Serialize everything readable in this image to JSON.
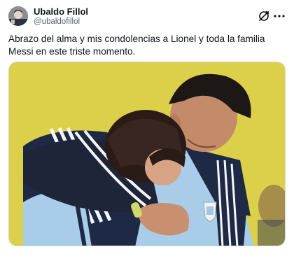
{
  "tweet": {
    "author": {
      "display_name": "Ubaldo Fillol",
      "handle": "@ubaldofillol"
    },
    "text": "Abrazo del alma y mis condolencias a Lionel y toda la familia Messi en este triste momento.",
    "header_icons": [
      "grok-icon",
      "more-options-icon"
    ],
    "media": {
      "type": "photo",
      "kit_colors": {
        "sky_blue": "#a9cde8",
        "navy": "#1e2a45",
        "white": "#f4f6f8"
      }
    }
  },
  "colors": {
    "text_primary": "#0f1419",
    "text_secondary": "#536471",
    "border": "#cfd9de",
    "photo_background": "#d9cd45"
  }
}
